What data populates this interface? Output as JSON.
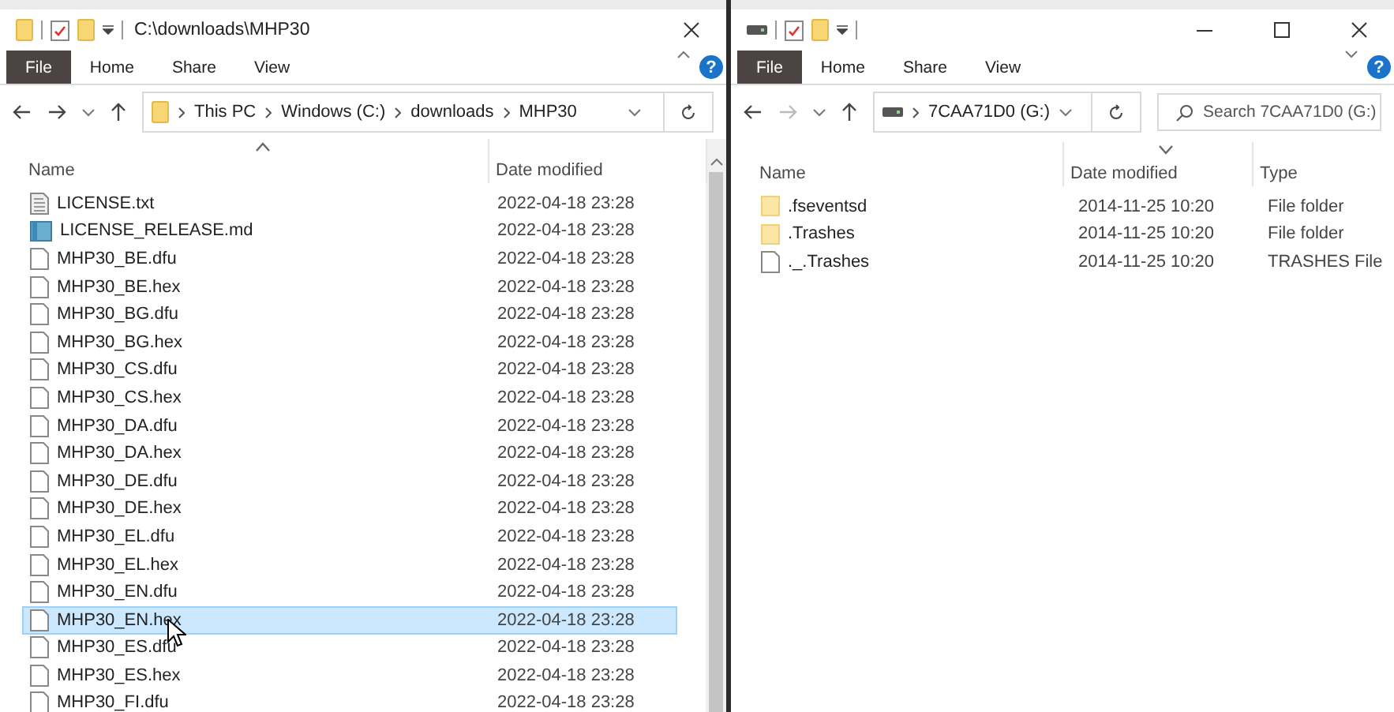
{
  "left_window": {
    "title": "C:\\downloads\\MHP30",
    "ribbon_tabs": [
      {
        "label": "File",
        "kind": "file"
      },
      {
        "label": "Home",
        "kind": "tab"
      },
      {
        "label": "Share",
        "kind": "tab"
      },
      {
        "label": "View",
        "kind": "tab"
      }
    ],
    "help": "?",
    "breadcrumb": [
      "This PC",
      "Windows (C:)",
      "downloads",
      "MHP30"
    ],
    "columns": [
      {
        "label": "Name",
        "sorted": true,
        "descending": false
      },
      {
        "label": "Date modified",
        "sorted": false
      }
    ],
    "rows": [
      {
        "name": "LICENSE.txt",
        "kind": "text",
        "date": "2022-04-18 23:28",
        "selected": false
      },
      {
        "name": "LICENSE_RELEASE.md",
        "kind": "md",
        "date": "2022-04-18 23:28",
        "selected": false
      },
      {
        "name": "MHP30_BE.dfu",
        "kind": "file",
        "date": "2022-04-18 23:28",
        "selected": false
      },
      {
        "name": "MHP30_BE.hex",
        "kind": "file",
        "date": "2022-04-18 23:28",
        "selected": false
      },
      {
        "name": "MHP30_BG.dfu",
        "kind": "file",
        "date": "2022-04-18 23:28",
        "selected": false
      },
      {
        "name": "MHP30_BG.hex",
        "kind": "file",
        "date": "2022-04-18 23:28",
        "selected": false
      },
      {
        "name": "MHP30_CS.dfu",
        "kind": "file",
        "date": "2022-04-18 23:28",
        "selected": false
      },
      {
        "name": "MHP30_CS.hex",
        "kind": "file",
        "date": "2022-04-18 23:28",
        "selected": false
      },
      {
        "name": "MHP30_DA.dfu",
        "kind": "file",
        "date": "2022-04-18 23:28",
        "selected": false
      },
      {
        "name": "MHP30_DA.hex",
        "kind": "file",
        "date": "2022-04-18 23:28",
        "selected": false
      },
      {
        "name": "MHP30_DE.dfu",
        "kind": "file",
        "date": "2022-04-18 23:28",
        "selected": false
      },
      {
        "name": "MHP30_DE.hex",
        "kind": "file",
        "date": "2022-04-18 23:28",
        "selected": false
      },
      {
        "name": "MHP30_EL.dfu",
        "kind": "file",
        "date": "2022-04-18 23:28",
        "selected": false
      },
      {
        "name": "MHP30_EL.hex",
        "kind": "file",
        "date": "2022-04-18 23:28",
        "selected": false
      },
      {
        "name": "MHP30_EN.dfu",
        "kind": "file",
        "date": "2022-04-18 23:28",
        "selected": false
      },
      {
        "name": "MHP30_EN.hex",
        "kind": "file",
        "date": "2022-04-18 23:28",
        "selected": true
      },
      {
        "name": "MHP30_ES.dfu",
        "kind": "file",
        "date": "2022-04-18 23:28",
        "selected": false
      },
      {
        "name": "MHP30_ES.hex",
        "kind": "file",
        "date": "2022-04-18 23:28",
        "selected": false
      },
      {
        "name": "MHP30_FI.dfu",
        "kind": "file",
        "date": "2022-04-18 23:28",
        "selected": false
      }
    ]
  },
  "right_window": {
    "ribbon_tabs": [
      {
        "label": "File",
        "kind": "file"
      },
      {
        "label": "Home",
        "kind": "tab"
      },
      {
        "label": "Share",
        "kind": "tab"
      },
      {
        "label": "View",
        "kind": "tab"
      }
    ],
    "help": "?",
    "breadcrumb": [
      "7CAA71D0 (G:)"
    ],
    "search": {
      "placeholder": "Search 7CAA71D0 (G:)"
    },
    "columns": [
      {
        "label": "Name",
        "sorted": false
      },
      {
        "label": "Date modified",
        "sorted": true,
        "descending": true
      },
      {
        "label": "Type",
        "sorted": false
      }
    ],
    "rows": [
      {
        "name": ".fseventsd",
        "kind": "folder",
        "date": "2014-11-25 10:20",
        "type": "File folder",
        "selected": false
      },
      {
        "name": ".Trashes",
        "kind": "folder",
        "date": "2014-11-25 10:20",
        "type": "File folder",
        "selected": false
      },
      {
        "name": "._.Trashes",
        "kind": "file",
        "date": "2014-11-25 10:20",
        "type": "TRASHES File",
        "selected": false
      }
    ]
  }
}
